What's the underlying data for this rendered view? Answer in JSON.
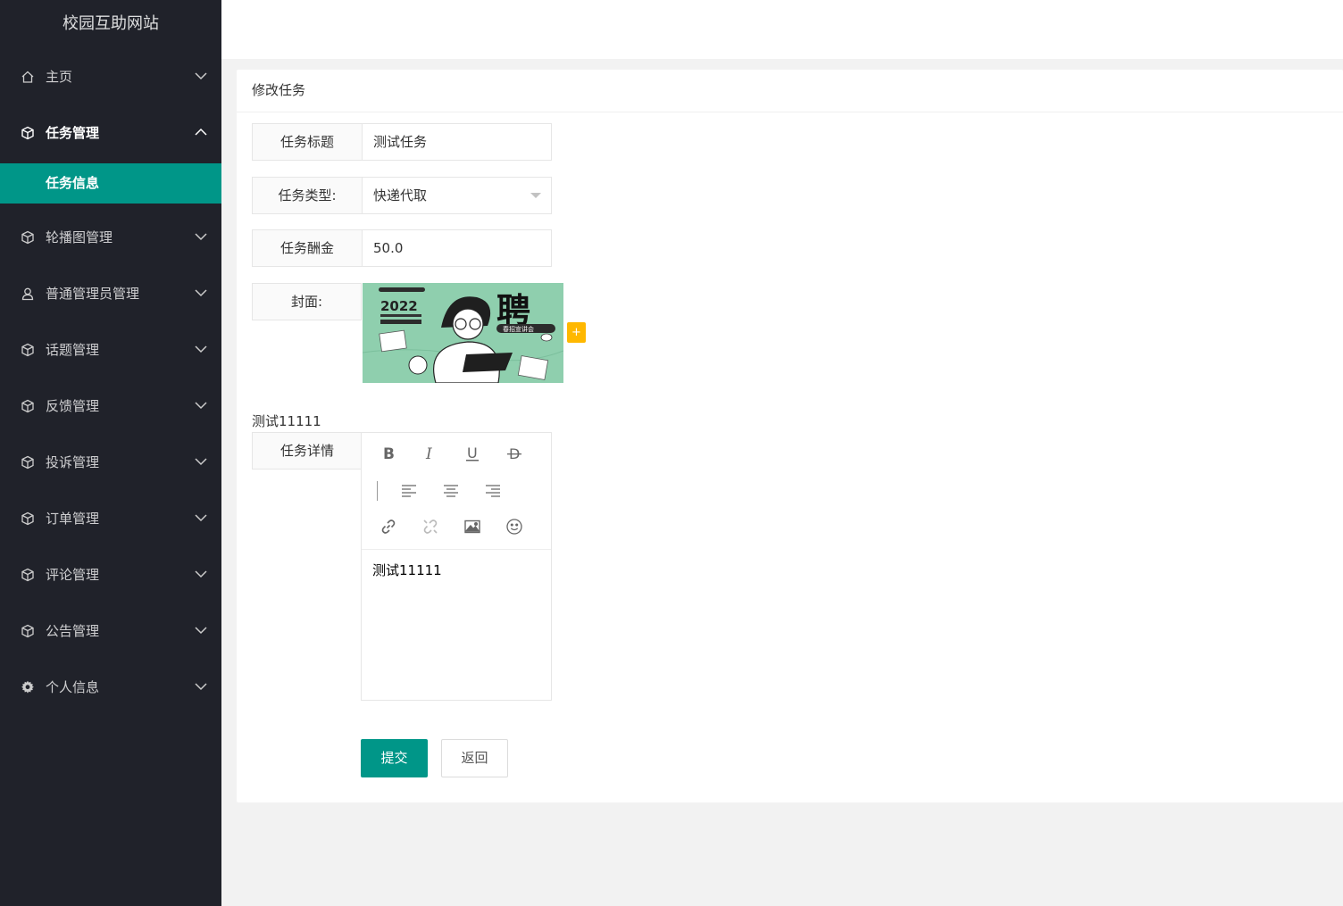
{
  "app": {
    "title": "校园互助网站"
  },
  "sidebar": {
    "items": [
      {
        "label": "主页",
        "icon": "home-icon"
      },
      {
        "label": "任务管理",
        "icon": "cube-icon",
        "expanded": true,
        "children": [
          {
            "label": "任务信息",
            "active": true
          }
        ]
      },
      {
        "label": "轮播图管理",
        "icon": "cube-icon"
      },
      {
        "label": "普通管理员管理",
        "icon": "user-icon"
      },
      {
        "label": "话题管理",
        "icon": "cube-icon"
      },
      {
        "label": "反馈管理",
        "icon": "cube-icon"
      },
      {
        "label": "投诉管理",
        "icon": "cube-icon"
      },
      {
        "label": "订单管理",
        "icon": "cube-icon"
      },
      {
        "label": "评论管理",
        "icon": "cube-icon"
      },
      {
        "label": "公告管理",
        "icon": "cube-icon"
      },
      {
        "label": "个人信息",
        "icon": "gear-icon"
      }
    ]
  },
  "card": {
    "title": "修改任务"
  },
  "form": {
    "title_label": "任务标题",
    "title_value": "测试任务",
    "type_label": "任务类型:",
    "type_value": "快递代取",
    "reward_label": "任务酬金",
    "reward_value": "50.0",
    "cover_label": "封面:",
    "cover_image": {
      "year": "2022",
      "headline": "聘",
      "badge": "春招宣讲会"
    },
    "upload_label": "+",
    "detail_preview": "测试11111",
    "detail_label": "任务详情",
    "editor_content": "测试11111"
  },
  "buttons": {
    "submit": "提交",
    "back": "返回"
  },
  "colors": {
    "sidebar_bg": "#20222a",
    "accent": "#009688",
    "upload": "#ffb800",
    "page_bg": "#f2f2f2"
  }
}
